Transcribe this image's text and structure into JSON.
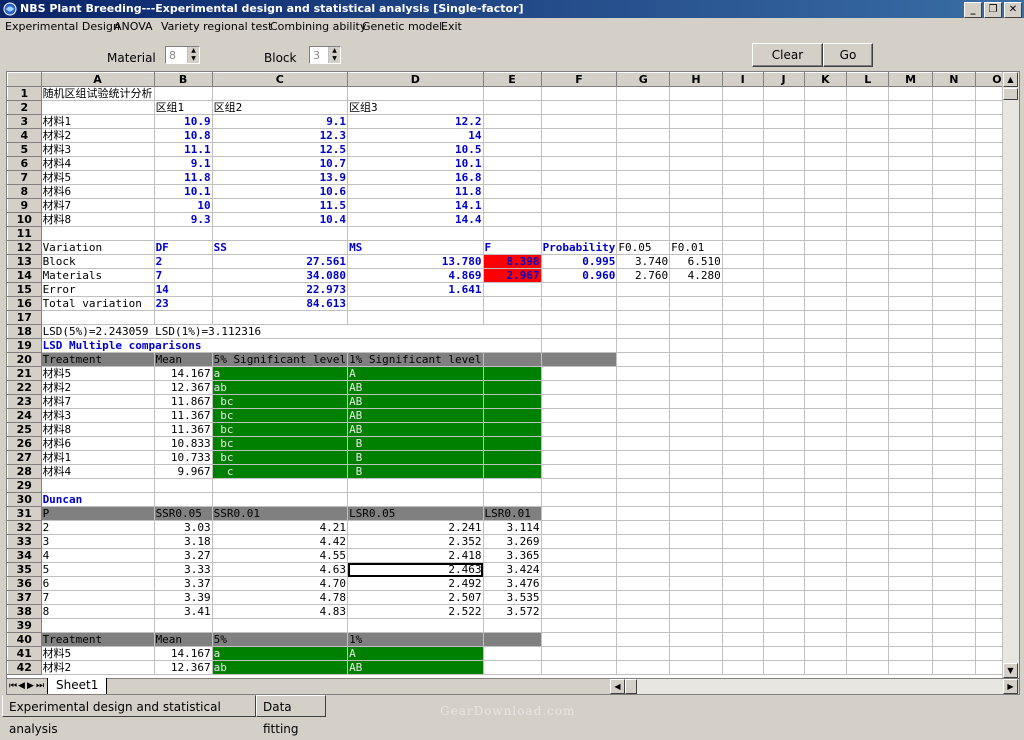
{
  "window": {
    "title": "NBS Plant Breeding---Experimental design and statistical analysis [Single-factor]",
    "buttons": [
      "_",
      "❐",
      "✕"
    ]
  },
  "menu": [
    "Experimental Design",
    "ANOVA",
    "Variety regional test",
    "Combining ability",
    "Genetic model",
    "Exit"
  ],
  "toolbar": {
    "material_label": "Material",
    "material_value": "8",
    "block_label": "Block",
    "block_value": "3",
    "clear_label": "Clear",
    "go_label": "Go"
  },
  "grid": {
    "columns": [
      "A",
      "B",
      "C",
      "D",
      "E",
      "F",
      "G",
      "H",
      "I",
      "J",
      "K",
      "L",
      "M",
      "N",
      "O"
    ],
    "rows": [
      {
        "n": "1",
        "cells": [
          {
            "c": 0,
            "v": "随机区组试验统计分析"
          }
        ]
      },
      {
        "n": "2",
        "cells": [
          {
            "c": 1,
            "v": "区组1"
          },
          {
            "c": 2,
            "v": "区组2"
          },
          {
            "c": 3,
            "v": "区组3"
          }
        ]
      },
      {
        "n": "3",
        "cells": [
          {
            "c": 0,
            "v": "材料1"
          },
          {
            "c": 1,
            "v": "10.9",
            "s": "rb"
          },
          {
            "c": 2,
            "v": "9.1",
            "s": "rb"
          },
          {
            "c": 3,
            "v": "12.2",
            "s": "rb"
          }
        ]
      },
      {
        "n": "4",
        "cells": [
          {
            "c": 0,
            "v": "材料2"
          },
          {
            "c": 1,
            "v": "10.8",
            "s": "rb"
          },
          {
            "c": 2,
            "v": "12.3",
            "s": "rb"
          },
          {
            "c": 3,
            "v": "14",
            "s": "rb"
          }
        ]
      },
      {
        "n": "5",
        "cells": [
          {
            "c": 0,
            "v": "材料3"
          },
          {
            "c": 1,
            "v": "11.1",
            "s": "rb"
          },
          {
            "c": 2,
            "v": "12.5",
            "s": "rb"
          },
          {
            "c": 3,
            "v": "10.5",
            "s": "rb"
          }
        ]
      },
      {
        "n": "6",
        "cells": [
          {
            "c": 0,
            "v": "材料4"
          },
          {
            "c": 1,
            "v": "9.1",
            "s": "rb"
          },
          {
            "c": 2,
            "v": "10.7",
            "s": "rb"
          },
          {
            "c": 3,
            "v": "10.1",
            "s": "rb"
          }
        ]
      },
      {
        "n": "7",
        "cells": [
          {
            "c": 0,
            "v": "材料5"
          },
          {
            "c": 1,
            "v": "11.8",
            "s": "rb"
          },
          {
            "c": 2,
            "v": "13.9",
            "s": "rb"
          },
          {
            "c": 3,
            "v": "16.8",
            "s": "rb"
          }
        ]
      },
      {
        "n": "8",
        "cells": [
          {
            "c": 0,
            "v": "材料6"
          },
          {
            "c": 1,
            "v": "10.1",
            "s": "rb"
          },
          {
            "c": 2,
            "v": "10.6",
            "s": "rb"
          },
          {
            "c": 3,
            "v": "11.8",
            "s": "rb"
          }
        ]
      },
      {
        "n": "9",
        "cells": [
          {
            "c": 0,
            "v": "材料7"
          },
          {
            "c": 1,
            "v": "10",
            "s": "rb"
          },
          {
            "c": 2,
            "v": "11.5",
            "s": "rb"
          },
          {
            "c": 3,
            "v": "14.1",
            "s": "rb"
          }
        ]
      },
      {
        "n": "10",
        "cells": [
          {
            "c": 0,
            "v": "材料8"
          },
          {
            "c": 1,
            "v": "9.3",
            "s": "rb"
          },
          {
            "c": 2,
            "v": "10.4",
            "s": "rb"
          },
          {
            "c": 3,
            "v": "14.4",
            "s": "rb"
          }
        ]
      },
      {
        "n": "11",
        "cells": []
      },
      {
        "n": "12",
        "cells": [
          {
            "c": 0,
            "v": "Variation"
          },
          {
            "c": 1,
            "v": "DF",
            "s": "b"
          },
          {
            "c": 2,
            "v": "SS",
            "s": "b"
          },
          {
            "c": 3,
            "v": "MS",
            "s": "b"
          },
          {
            "c": 4,
            "v": "F",
            "s": "b"
          },
          {
            "c": 5,
            "v": "Probability",
            "s": "b"
          },
          {
            "c": 6,
            "v": "F0.05"
          },
          {
            "c": 7,
            "v": "F0.01"
          }
        ]
      },
      {
        "n": "13",
        "cells": [
          {
            "c": 0,
            "v": "Block"
          },
          {
            "c": 1,
            "v": "2",
            "s": "b"
          },
          {
            "c": 2,
            "v": "27.561",
            "s": "rb"
          },
          {
            "c": 3,
            "v": "13.780",
            "s": "rb"
          },
          {
            "c": 4,
            "v": "8.398",
            "s": "red"
          },
          {
            "c": 5,
            "v": "0.995",
            "s": "rb"
          },
          {
            "c": 6,
            "v": "3.740",
            "s": "r"
          },
          {
            "c": 7,
            "v": "6.510",
            "s": "r"
          }
        ]
      },
      {
        "n": "14",
        "cells": [
          {
            "c": 0,
            "v": "Materials"
          },
          {
            "c": 1,
            "v": "7",
            "s": "b"
          },
          {
            "c": 2,
            "v": "34.080",
            "s": "rb"
          },
          {
            "c": 3,
            "v": "4.869",
            "s": "rb"
          },
          {
            "c": 4,
            "v": "2.967",
            "s": "red"
          },
          {
            "c": 5,
            "v": "0.960",
            "s": "rb"
          },
          {
            "c": 6,
            "v": "2.760",
            "s": "r"
          },
          {
            "c": 7,
            "v": "4.280",
            "s": "r"
          }
        ]
      },
      {
        "n": "15",
        "cells": [
          {
            "c": 0,
            "v": "Error"
          },
          {
            "c": 1,
            "v": "14",
            "s": "b"
          },
          {
            "c": 2,
            "v": "22.973",
            "s": "rb"
          },
          {
            "c": 3,
            "v": "1.641",
            "s": "rb"
          }
        ]
      },
      {
        "n": "16",
        "cells": [
          {
            "c": 0,
            "v": "Total variation"
          },
          {
            "c": 1,
            "v": "23",
            "s": "b"
          },
          {
            "c": 2,
            "v": "84.613",
            "s": "rb"
          }
        ]
      },
      {
        "n": "17",
        "cells": []
      },
      {
        "n": "18",
        "cells": [
          {
            "c": 0,
            "v": "LSD(5%)=2.243059  LSD(1%)=3.112316",
            "span": 5
          }
        ]
      },
      {
        "n": "19",
        "cells": [
          {
            "c": 0,
            "v": "LSD Multiple comparisons",
            "s": "b",
            "span": 5
          }
        ]
      },
      {
        "n": "20",
        "cells": [
          {
            "c": 0,
            "v": "Treatment",
            "s": "g"
          },
          {
            "c": 1,
            "v": "Mean",
            "s": "g"
          },
          {
            "c": 2,
            "v": "5% Significant level",
            "s": "g"
          },
          {
            "c": 3,
            "v": "1% Significant level",
            "s": "g"
          },
          {
            "c": 4,
            "v": "",
            "s": "g"
          },
          {
            "c": 5,
            "v": "",
            "s": "g"
          }
        ]
      },
      {
        "n": "21",
        "cells": [
          {
            "c": 0,
            "v": "材料5"
          },
          {
            "c": 1,
            "v": "14.167",
            "s": "r"
          },
          {
            "c": 2,
            "v": "a",
            "s": "gr"
          },
          {
            "c": 3,
            "v": "A",
            "s": "gr"
          },
          {
            "c": 4,
            "v": "",
            "s": "gr"
          }
        ]
      },
      {
        "n": "22",
        "cells": [
          {
            "c": 0,
            "v": "材料2"
          },
          {
            "c": 1,
            "v": "12.367",
            "s": "r"
          },
          {
            "c": 2,
            "v": "ab",
            "s": "gr"
          },
          {
            "c": 3,
            "v": "AB",
            "s": "gr"
          },
          {
            "c": 4,
            "v": "",
            "s": "gr"
          }
        ]
      },
      {
        "n": "23",
        "cells": [
          {
            "c": 0,
            "v": "材料7"
          },
          {
            "c": 1,
            "v": "11.867",
            "s": "r"
          },
          {
            "c": 2,
            "v": " bc",
            "s": "gr"
          },
          {
            "c": 3,
            "v": "AB",
            "s": "gr"
          },
          {
            "c": 4,
            "v": "",
            "s": "gr"
          }
        ]
      },
      {
        "n": "24",
        "cells": [
          {
            "c": 0,
            "v": "材料3"
          },
          {
            "c": 1,
            "v": "11.367",
            "s": "r"
          },
          {
            "c": 2,
            "v": " bc",
            "s": "gr"
          },
          {
            "c": 3,
            "v": "AB",
            "s": "gr"
          },
          {
            "c": 4,
            "v": "",
            "s": "gr"
          }
        ]
      },
      {
        "n": "25",
        "cells": [
          {
            "c": 0,
            "v": "材料8"
          },
          {
            "c": 1,
            "v": "11.367",
            "s": "r"
          },
          {
            "c": 2,
            "v": " bc",
            "s": "gr"
          },
          {
            "c": 3,
            "v": "AB",
            "s": "gr"
          },
          {
            "c": 4,
            "v": "",
            "s": "gr"
          }
        ]
      },
      {
        "n": "26",
        "cells": [
          {
            "c": 0,
            "v": "材料6"
          },
          {
            "c": 1,
            "v": "10.833",
            "s": "r"
          },
          {
            "c": 2,
            "v": " bc",
            "s": "gr"
          },
          {
            "c": 3,
            "v": " B",
            "s": "gr"
          },
          {
            "c": 4,
            "v": "",
            "s": "gr"
          }
        ]
      },
      {
        "n": "27",
        "cells": [
          {
            "c": 0,
            "v": "材料1"
          },
          {
            "c": 1,
            "v": "10.733",
            "s": "r"
          },
          {
            "c": 2,
            "v": " bc",
            "s": "gr"
          },
          {
            "c": 3,
            "v": " B",
            "s": "gr"
          },
          {
            "c": 4,
            "v": "",
            "s": "gr"
          }
        ]
      },
      {
        "n": "28",
        "cells": [
          {
            "c": 0,
            "v": "材料4"
          },
          {
            "c": 1,
            "v": "9.967",
            "s": "r"
          },
          {
            "c": 2,
            "v": "  c",
            "s": "gr"
          },
          {
            "c": 3,
            "v": " B",
            "s": "gr"
          },
          {
            "c": 4,
            "v": "",
            "s": "gr"
          }
        ]
      },
      {
        "n": "29",
        "cells": []
      },
      {
        "n": "30",
        "cells": [
          {
            "c": 0,
            "v": "Duncan",
            "s": "b"
          }
        ]
      },
      {
        "n": "31",
        "cells": [
          {
            "c": 0,
            "v": "P",
            "s": "g"
          },
          {
            "c": 1,
            "v": "SSR0.05",
            "s": "g"
          },
          {
            "c": 2,
            "v": "SSR0.01",
            "s": "g"
          },
          {
            "c": 3,
            "v": "LSR0.05",
            "s": "g"
          },
          {
            "c": 4,
            "v": "LSR0.01",
            "s": "g"
          }
        ]
      },
      {
        "n": "32",
        "cells": [
          {
            "c": 0,
            "v": "2"
          },
          {
            "c": 1,
            "v": "3.03",
            "s": "r"
          },
          {
            "c": 2,
            "v": "4.21",
            "s": "r"
          },
          {
            "c": 3,
            "v": "2.241",
            "s": "r"
          },
          {
            "c": 4,
            "v": "3.114",
            "s": "r"
          }
        ]
      },
      {
        "n": "33",
        "cells": [
          {
            "c": 0,
            "v": "3"
          },
          {
            "c": 1,
            "v": "3.18",
            "s": "r"
          },
          {
            "c": 2,
            "v": "4.42",
            "s": "r"
          },
          {
            "c": 3,
            "v": "2.352",
            "s": "r"
          },
          {
            "c": 4,
            "v": "3.269",
            "s": "r"
          }
        ]
      },
      {
        "n": "34",
        "cells": [
          {
            "c": 0,
            "v": "4"
          },
          {
            "c": 1,
            "v": "3.27",
            "s": "r"
          },
          {
            "c": 2,
            "v": "4.55",
            "s": "r"
          },
          {
            "c": 3,
            "v": "2.418",
            "s": "r"
          },
          {
            "c": 4,
            "v": "3.365",
            "s": "r"
          }
        ]
      },
      {
        "n": "35",
        "cells": [
          {
            "c": 0,
            "v": "5"
          },
          {
            "c": 1,
            "v": "3.33",
            "s": "r"
          },
          {
            "c": 2,
            "v": "4.63",
            "s": "r"
          },
          {
            "c": 3,
            "v": "2.463",
            "s": "rsel"
          },
          {
            "c": 4,
            "v": "3.424",
            "s": "r"
          }
        ]
      },
      {
        "n": "36",
        "cells": [
          {
            "c": 0,
            "v": "6"
          },
          {
            "c": 1,
            "v": "3.37",
            "s": "r"
          },
          {
            "c": 2,
            "v": "4.70",
            "s": "r"
          },
          {
            "c": 3,
            "v": "2.492",
            "s": "r"
          },
          {
            "c": 4,
            "v": "3.476",
            "s": "r"
          }
        ]
      },
      {
        "n": "37",
        "cells": [
          {
            "c": 0,
            "v": "7"
          },
          {
            "c": 1,
            "v": "3.39",
            "s": "r"
          },
          {
            "c": 2,
            "v": "4.78",
            "s": "r"
          },
          {
            "c": 3,
            "v": "2.507",
            "s": "r"
          },
          {
            "c": 4,
            "v": "3.535",
            "s": "r"
          }
        ]
      },
      {
        "n": "38",
        "cells": [
          {
            "c": 0,
            "v": "8"
          },
          {
            "c": 1,
            "v": "3.41",
            "s": "r"
          },
          {
            "c": 2,
            "v": "4.83",
            "s": "r"
          },
          {
            "c": 3,
            "v": "2.522",
            "s": "r"
          },
          {
            "c": 4,
            "v": "3.572",
            "s": "r"
          }
        ]
      },
      {
        "n": "39",
        "cells": []
      },
      {
        "n": "40",
        "cells": [
          {
            "c": 0,
            "v": "Treatment",
            "s": "g"
          },
          {
            "c": 1,
            "v": "Mean",
            "s": "g"
          },
          {
            "c": 2,
            "v": "5%",
            "s": "g"
          },
          {
            "c": 3,
            "v": "1%",
            "s": "g"
          },
          {
            "c": 4,
            "v": "",
            "s": "g"
          }
        ]
      },
      {
        "n": "41",
        "cells": [
          {
            "c": 0,
            "v": "材料5"
          },
          {
            "c": 1,
            "v": "14.167",
            "s": "r"
          },
          {
            "c": 2,
            "v": "a",
            "s": "gr"
          },
          {
            "c": 3,
            "v": "A",
            "s": "gr"
          }
        ]
      },
      {
        "n": "42",
        "cells": [
          {
            "c": 0,
            "v": "材料2"
          },
          {
            "c": 1,
            "v": "12.367",
            "s": "r"
          },
          {
            "c": 2,
            "v": "ab",
            "s": "gr"
          },
          {
            "c": 3,
            "v": "AB",
            "s": "gr"
          }
        ]
      }
    ]
  },
  "sheet_tab": "Sheet1",
  "app_tabs": [
    "Experimental design and statistical analysis",
    "Data fitting"
  ],
  "watermark": "GearDownload.com",
  "colors": {
    "title_start": "#0a246a",
    "title_end": "#3a6ea5",
    "highlight_red": "#ff0000",
    "highlight_green": "#008000",
    "header_gray": "#808080",
    "value_blue": "#0000cc"
  }
}
